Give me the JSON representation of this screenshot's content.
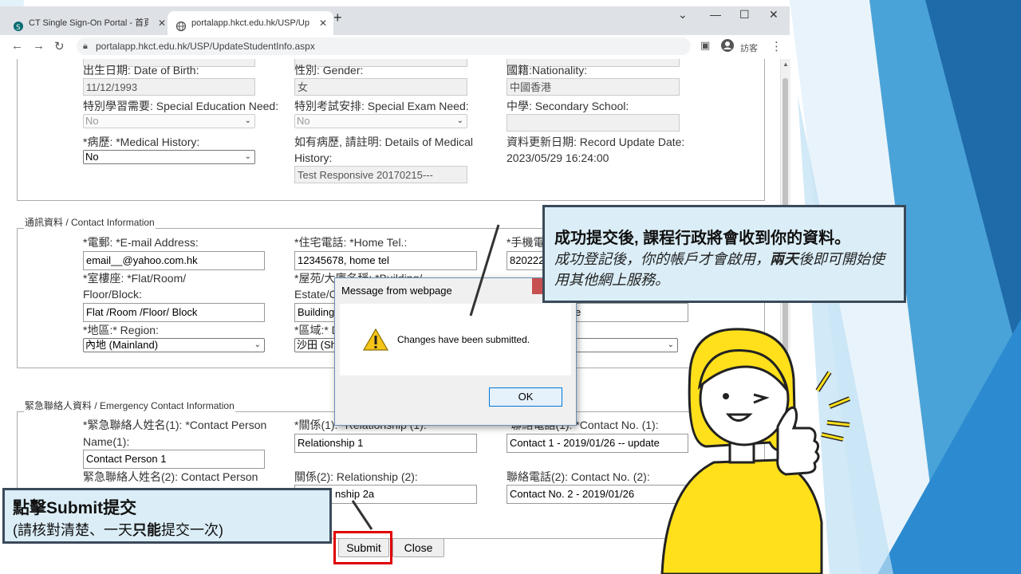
{
  "browser": {
    "tabs": [
      {
        "label": "CT Single Sign-On Portal - 首頁"
      },
      {
        "label": "portalapp.hkct.edu.hk/USP/Up"
      }
    ],
    "url": "portalapp.hkct.edu.hk/USP/UpdateStudentInfo.aspx",
    "profile_label": "訪客"
  },
  "personal": {
    "dob_label": "出生日期: Date of Birth:",
    "dob_value": "11/12/1993",
    "gender_label": "性別: Gender:",
    "gender_value": "女",
    "nationality_label": "國籍:Nationality:",
    "nationality_value": "中國香港",
    "sen_label": "特別學習需要: Special Education Need:",
    "sen_value": "No",
    "exam_label": "特別考試安排: Special Exam Need:",
    "exam_value": "No",
    "school_label": "中學: Secondary School:",
    "school_value": "",
    "medical_label": "*病歷: *Medical History:",
    "medical_value": "No",
    "medical_details_label_1": "如有病歷, 請註明: Details of Medical",
    "medical_details_label_2": "History:",
    "medical_details_value": "Test Responsive 20170215---",
    "update_label": "資料更新日期: Record Update Date:",
    "update_value": "2023/05/29 16:24:00"
  },
  "contact": {
    "legend": "通訊資料 / Contact Information",
    "email_label": "*電郵: *E-mail Address:",
    "email_value": "email__@yahoo.com.hk",
    "hometel_label": "*住宅電話: *Home Tel.:",
    "hometel_value": "12345678, home tel",
    "mobile_label": "*手機電",
    "mobile_value": "820222",
    "flat_label_1": "*室樓座: *Flat/Room/",
    "flat_label_2": "Floor/Block:",
    "flat_value": "Flat /Room /Floor/ Block",
    "building_label_1": "*屋苑/大廈名稱: *Building/",
    "building_label_2": "Estate/C",
    "building_value": "Building",
    "street_partial": "e",
    "region_label": "*地區:* Region:",
    "region_value": "內地 (Mainland)",
    "district_label": "*區域:* D",
    "district_value": "沙田 (Sh"
  },
  "emergency": {
    "legend": "緊急聯絡人資料 / Emergency Contact Information",
    "name1_label_1": "*緊急聯絡人姓名(1): *Contact Person",
    "name1_label_2": "Name(1):",
    "name1_value": "Contact Person 1",
    "rel1_label": "*關係(1): *Relationship (1):",
    "rel1_value": "Relationship 1",
    "tel1_label": "*聯絡電話(1): *Contact No. (1):",
    "tel1_value": "Contact 1 - 2019/01/26 -- update",
    "name2_label": "緊急聯絡人姓名(2): Contact Person",
    "rel2_label": "關係(2): Relationship (2):",
    "rel2_value": "nship 2a",
    "tel2_label": "聯絡電話(2): Contact No. (2):",
    "tel2_value": "Contact No. 2 - 2019/01/26"
  },
  "buttons": {
    "submit": "Submit",
    "close": "Close"
  },
  "dialog": {
    "title": "Message from webpage",
    "message": "Changes have been submitted.",
    "ok": "OK"
  },
  "callout_top": {
    "line1": "成功提交後, 課程行政將會收到你的資料。",
    "line2a": "成功登記後，你的帳戶才會啟用，",
    "line2b": "兩天",
    "line2c": "後即可開始使用其他網上服務。"
  },
  "callout_bottom": {
    "line1": "點擊Submit提交",
    "line2a": "(請核對清楚、一天",
    "line2b": "只能",
    "line2c": "提交一次)"
  },
  "colors": {
    "slide_blue": "#2f7fc1",
    "callout_bg": "#dbeef7",
    "highlight_red": "#e00000",
    "character_yellow": "#ffe01b"
  }
}
